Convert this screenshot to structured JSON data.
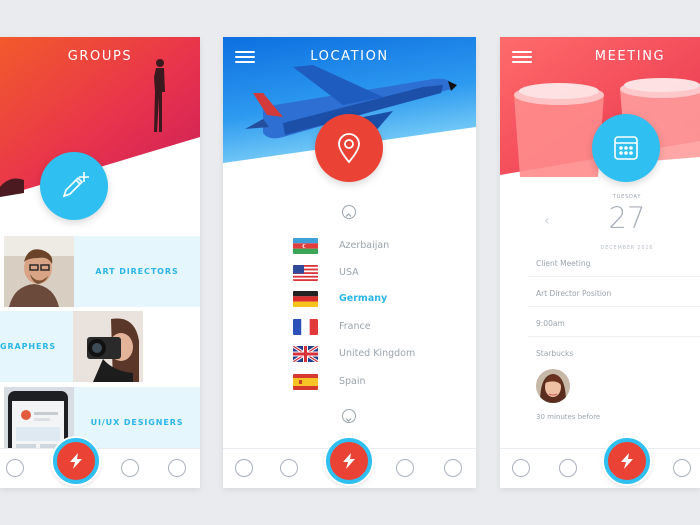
{
  "groups": {
    "title": "GROUPS",
    "tiles": [
      {
        "label": "ART DIRECTORS"
      },
      {
        "label": "GRAPHERS"
      },
      {
        "label": "UI/UX DESIGNERS"
      }
    ]
  },
  "location": {
    "title": "LOCATION",
    "countries": [
      {
        "name": "Azerbaijan",
        "selected": false
      },
      {
        "name": "USA",
        "selected": false
      },
      {
        "name": "Germany",
        "selected": true
      },
      {
        "name": "France",
        "selected": false
      },
      {
        "name": "United Kingdom",
        "selected": false
      },
      {
        "name": "Spain",
        "selected": false
      }
    ]
  },
  "meeting": {
    "title": "MEETING",
    "day_name": "TUESDAY",
    "day_number": "27",
    "month_year": "DECEMBER 2016",
    "items": [
      "Client Meeting",
      "Art Director Position",
      "9:00am",
      "Starbucks"
    ],
    "reminder": "30 minutes before"
  },
  "colors": {
    "accent_red": "#ea4335",
    "accent_blue": "#2fc0f1",
    "selected_text": "#2ab6e8"
  },
  "icons": [
    "pencil-plus-icon",
    "location-pin-icon",
    "calendar-grid-icon",
    "lightning-icon",
    "user-icon",
    "chat-icon",
    "mail-icon",
    "clock-icon",
    "hamburger-menu-icon",
    "chevron-up-icon",
    "chevron-down-icon",
    "chevron-left-icon"
  ]
}
